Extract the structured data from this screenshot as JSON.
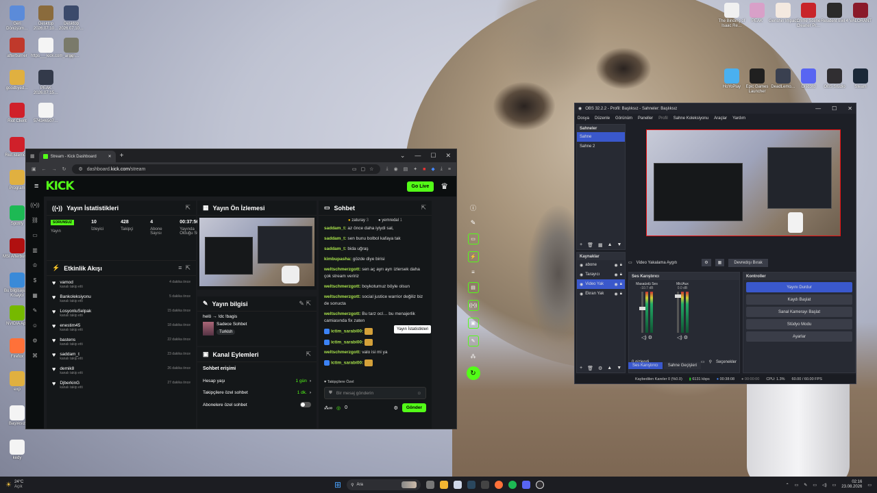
{
  "desktop_icons_left": [
    {
      "label": "Geri Dönüşüm…",
      "color": "#5b8bd9"
    },
    {
      "label": "Desktop 2026.07.10…",
      "color": "#8a6b3c"
    },
    {
      "label": "Desktop 2026.07.10…",
      "color": "#3b4a6b"
    },
    {
      "label": "afterburner",
      "color": "#c0392b"
    },
    {
      "label": "https___kick.com_aman…",
      "color": "#f4f4f4"
    },
    {
      "label": "gg",
      "color": "#7a7a6a"
    },
    {
      "label": "goodbyed…",
      "color": "#e0b040"
    },
    {
      "label": "PEAK 2026.07.15…",
      "color": "#333a4a"
    },
    {
      "label": "Riot Client",
      "color": "#d0202a"
    },
    {
      "label": "574346507…",
      "color": "#f4f4f4"
    },
    {
      "label": "Riot istemcisi",
      "color": "#d0202a"
    },
    {
      "label": "Program",
      "color": "#e0b040"
    },
    {
      "label": "Spotify",
      "color": "#1db954"
    },
    {
      "label": "MSI Afterburner",
      "color": "#b01010"
    },
    {
      "label": "Bu bilgisayar - Kısayol",
      "color": "#3a8ad8"
    },
    {
      "label": "NVIDIA App",
      "color": "#76b900"
    },
    {
      "label": "Firefox",
      "color": "#ff7139"
    },
    {
      "label": "exp",
      "color": "#e0b040"
    },
    {
      "label": "Başlıksız",
      "color": "#f4f4f4"
    },
    {
      "label": "kedy",
      "color": "#f4f4f4"
    }
  ],
  "desktop_icons_right": [
    {
      "label": "The Binding of Isaac Re…",
      "color": "#f0f0f0"
    },
    {
      "label": "PEAK",
      "color": "#d8a0c8"
    },
    {
      "label": "Genshin Impact",
      "color": "#f4e9e0"
    },
    {
      "label": "Crime Scene Cleaner Pr…",
      "color": "#c8242a"
    },
    {
      "label": "Resident Evil 4",
      "color": "#2a2a2a"
    },
    {
      "label": "VALORANT",
      "color": "#8a1a2a"
    },
    {
      "label": "HoYoPlay",
      "color": "#4ab0f0"
    },
    {
      "label": "Epic Games Launcher",
      "color": "#202020"
    },
    {
      "label": "DeadLemo…",
      "color": "#3a4050"
    },
    {
      "label": "Discord",
      "color": "#5865f2"
    },
    {
      "label": "OBS Studio",
      "color": "#302e31"
    },
    {
      "label": "Steam",
      "color": "#1b2838"
    }
  ],
  "browser": {
    "tab_title": "Stream - Kick Dashboard",
    "url_host": "dashboard.",
    "url_domain": "kick.com",
    "url_path": "/stream",
    "go_live": "Go Live"
  },
  "stats": {
    "title": "Yayın İstatistikleri",
    "status_badge": "SORUNSUZ",
    "status_label": "Yayın",
    "viewers": "10",
    "viewers_label": "İzleyici",
    "followers": "428",
    "followers_label": "Takipçi",
    "subs": "4",
    "subs_label": "Abone Sayısı",
    "uptime": "00:37:56",
    "uptime_label": "Yayında Olduğu Süre"
  },
  "activity": {
    "title": "Etkinlik Akışı",
    "items": [
      {
        "name": "vamod",
        "sub": "kanalı takip etti",
        "time": "4 dakika önce"
      },
      {
        "name": "Bankoleksiyonu",
        "sub": "kanalı takip etti",
        "time": "5 dakika önce"
      },
      {
        "name": "LosyonluSelpak",
        "sub": "kanalı takip etti",
        "time": "15 dakika önce"
      },
      {
        "name": "enestim45",
        "sub": "kanalı takip etti",
        "time": "18 dakika önce"
      },
      {
        "name": "bastens",
        "sub": "kanalı takip etti",
        "time": "22 dakika önce"
      },
      {
        "name": "saddam_t",
        "sub": "kanalı takip etti",
        "time": "23 dakika önce"
      },
      {
        "name": "demik8",
        "sub": "kanalı takip etti",
        "time": "26 dakika önce"
      },
      {
        "name": "DjberkinG",
        "sub": "kanalı takip etti",
        "time": "27 dakika önce"
      }
    ]
  },
  "preview": {
    "title": "Yayın Ön İzlemesi"
  },
  "stream_info": {
    "title": "Yayın bilgisi",
    "stream_title": "helö → !dc !bagis",
    "category": "Sadece Sohbet",
    "language": "Turkish"
  },
  "channel_actions": {
    "title": "Kanal Eylemleri",
    "chat_access": "Sohbet erişimi",
    "rows": [
      {
        "label": "Hesap yaşı",
        "value": "1 gün"
      },
      {
        "label": "Takipçilere özel sohbet",
        "value": "1 dk."
      },
      {
        "label": "Abonelere özel sohbet",
        "value": ""
      }
    ]
  },
  "chat": {
    "title": "Sohbet",
    "pinned_1": "zaturay",
    "pinned_1_count": "3",
    "pinned_2": "yemredal",
    "pinned_2_count": "1",
    "messages": [
      {
        "user": "saddam_t:",
        "text": "az önce daha iyiydi sal,"
      },
      {
        "user": "saddam_t:",
        "text": "sen bunu bolbol kafaya tak"
      },
      {
        "user": "saddam_t:",
        "text": "bida uğraş"
      },
      {
        "user": "kimbupasha:",
        "text": "gözde diye birisi"
      },
      {
        "user": "weltschmerzgott:",
        "text": "sen aç ayrı ayrı izlersek daha çok stream veririz"
      },
      {
        "user": "weltschmerzgott:",
        "text": "boykotumuz böyle olsun"
      },
      {
        "user": "weltschmerzgott:",
        "text": "social justice warrior değiliz biz de sonucta"
      },
      {
        "user": "weltschmerzgott:",
        "text": "Bu tarz ocl… bu menajerlik camiasında fix zaten"
      },
      {
        "user": "ictim_sarabi00:",
        "text": ""
      },
      {
        "user": "ictim_sarabi00:",
        "text": ""
      },
      {
        "user": "weltschmerzgott:",
        "text": "valo isi mi ya"
      },
      {
        "user": "ictim_sarabi00:",
        "text": ""
      }
    ],
    "followers_only": "Takipçilere Özel",
    "input_placeholder": "Bir mesaj gönderin",
    "points": "0",
    "send": "Gönder",
    "tooltip": "Yayın İstatistikleri"
  },
  "obs": {
    "title": "OBS 32.2.2 - Profil: Başlıksız - Sahneler: Başlıksız",
    "menu": [
      "Dosya",
      "Düzenle",
      "Görünüm",
      "Paneller",
      "Profil",
      "Sahne Koleksiyonu",
      "Araçlar",
      "Yardım"
    ],
    "scenes_title": "Sahneler",
    "scenes": [
      "Sahne",
      "Sahne 2"
    ],
    "sources_title": "Kaynaklar",
    "sources": [
      "abone",
      "Tarayıcı",
      "Video Yak",
      "Ekran Yak"
    ],
    "source_toolbar": "Video Yakalama Aygıtı",
    "deactivate": "Devredışı Bırak",
    "mixer_title": "Ses Karıştırıcı",
    "mixer_tracks": [
      {
        "name": "Masaüstü Ses",
        "db": "-10.7 dB"
      },
      {
        "name": "Mic/Aux",
        "db": "0.0 dB"
      }
    ],
    "mixer_hidden": "0 gizlendi",
    "options": "Seçenekler",
    "controls_title": "Kontroller",
    "controls": [
      "Yayını Durdur",
      "Kaydı Başlat",
      "Sanal Kamerayı Başlat",
      "Stüdyo Modu",
      "Ayarlar"
    ],
    "tab_mixer": "Ses Karıştırıcı",
    "tab_transitions": "Sahne Geçişleri",
    "status": {
      "dropped": "Kaybedilen Kareler 0 (%0.0)",
      "bitrate": "6131 kbps",
      "live": "00:38:08",
      "rec": "00:00:00",
      "cpu": "CPU: 1.3%",
      "fps": "60.00 / 60.00 FPS"
    }
  },
  "taskbar": {
    "weather_temp": "24°C",
    "weather_desc": "Açık",
    "search": "Ara",
    "time": "02:16",
    "date": "23.08.2026"
  }
}
